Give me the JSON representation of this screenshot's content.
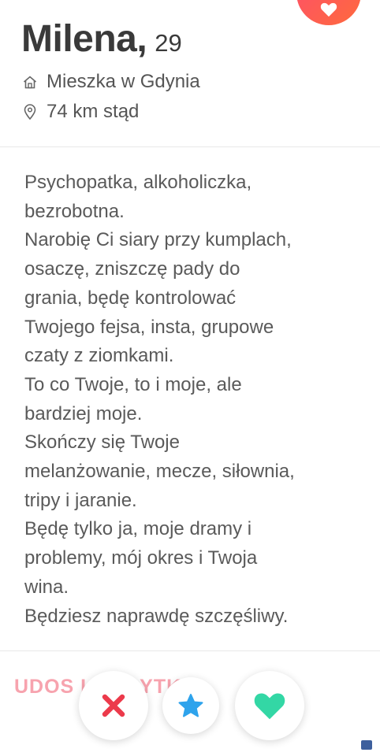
{
  "profile": {
    "name": "Milena,",
    "age": "29",
    "location": "Mieszka w Gdynia",
    "distance": "74 km stąd"
  },
  "bio_lines": [
    "Psychopatka, alkoholiczka,",
    "bezrobotna.",
    "Narobię Ci siary przy kumplach,",
    "osaczę, zniszczę pady do",
    "grania, będę kontrolować",
    "Twojego fejsa, insta, grupowe",
    "czaty z ziomkami.",
    "To co Twoje, to i moje, ale",
    "bardziej moje.",
    "Skończy się Twoje",
    "melanżowanie, mecze, siłownia,",
    "tripy i jaranie.",
    "Będę tylko ja, moje dramy i",
    "problemy, mój okres i Twoja",
    "wina.",
    "Będziesz naprawdę szczęśliwy."
  ],
  "share_text": "UDOS    IJ   OF       YTK...",
  "icons": {
    "top_button": "heart-icon",
    "location": "home-icon",
    "distance": "map-pin-icon",
    "nope": "close-icon",
    "super_like": "star-icon",
    "like": "heart-icon"
  },
  "colors": {
    "brand_gradient_start": "#fd5068",
    "brand_gradient_end": "#ff6a3d",
    "nope": "#ec3a4b",
    "super_like": "#2ea3ec",
    "like": "#33d7a5",
    "share_text": "#f7a3ae"
  }
}
